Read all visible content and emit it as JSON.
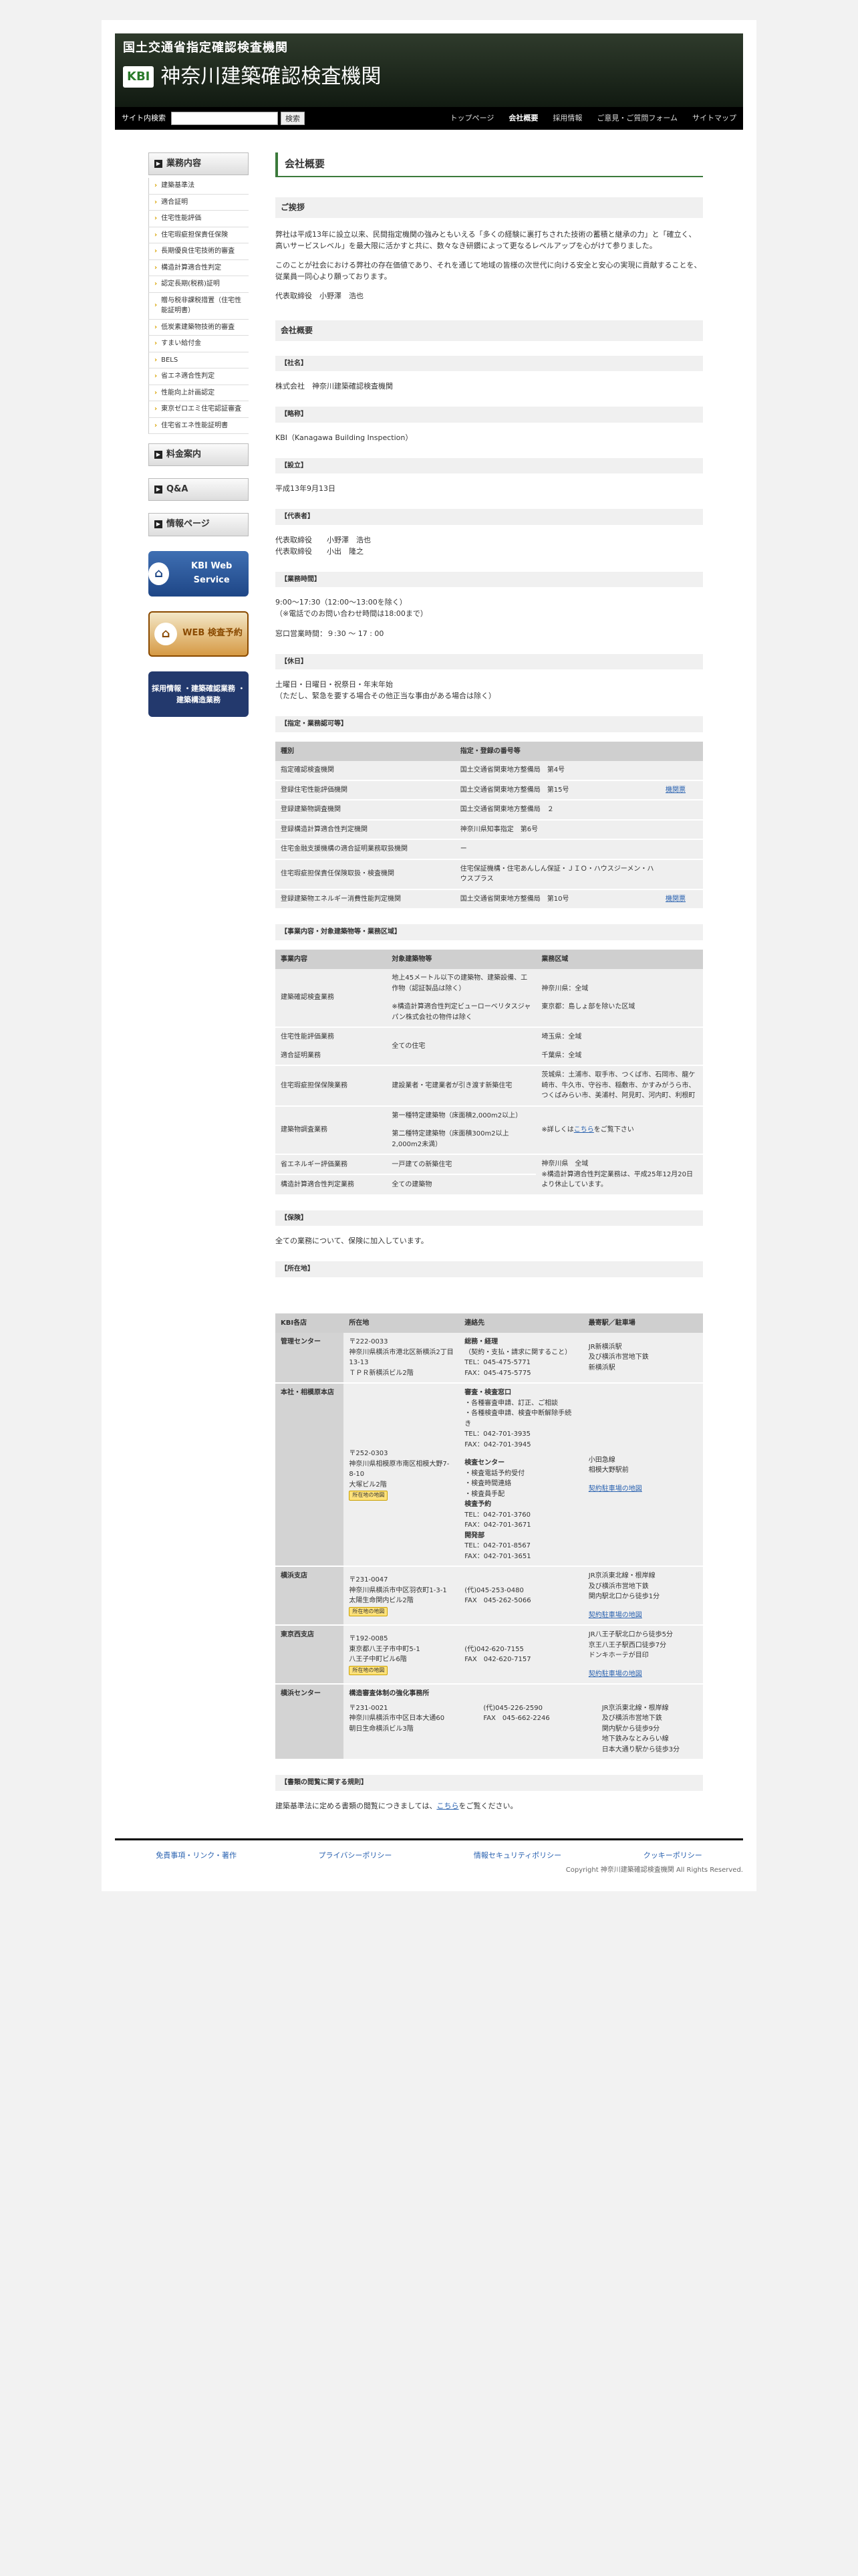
{
  "header": {
    "sub_title": "国土交通省指定確認検査機関",
    "logo": "KBI",
    "name": "神奈川建築確認検査機関"
  },
  "nav": {
    "search_label": "サイト内検索",
    "search_placeholder": "",
    "search_button": "検索",
    "links": [
      "トップページ",
      "会社概要",
      "採用情報",
      "ご意見・ご質問フォーム",
      "サイトマップ"
    ]
  },
  "sidebar": {
    "menu_head": "業務内容",
    "items": [
      "建築基準法",
      "適合証明",
      "住宅性能評価",
      "住宅瑕疵担保責任保険",
      "長期優良住宅技術的審査",
      "構造計算適合性判定",
      "認定長期(税務)証明",
      "贈与税非課税措置（住宅性能証明書）",
      "低炭素建築物技術的審査",
      "すまい給付金",
      "BELS",
      "省エネ適合性判定",
      "性能向上計画認定",
      "東京ゼロエミ住宅認証審査",
      "住宅省エネ性能証明書"
    ],
    "fee": "料金案内",
    "qa": "Q&A",
    "info": "情報ページ",
    "banner_kbi": "KBI Web Service",
    "banner_web": "WEB 検査予約",
    "banner_rec": "採用情報 ・建築確認業務 ・建築構造業務"
  },
  "content": {
    "title": "会社概要",
    "greeting_head": "ご挨拶",
    "greeting_p1": "弊社は平成13年に設立以来、民間指定機関の強みともいえる「多くの経験に裏打ちされた技術の蓄積と継承の力」と「確立く、高いサービスレベル」を最大限に活かすと共に、数々なき研鑽によって更なるレベルアップを心がけて参りました。",
    "greeting_p2": "このことが社会における弊社の存在価値であり、それを通じて地域の皆様の次世代に向ける安全と安心の実現に貢献することを、従業員一同心より願っております。",
    "greeting_sign": "代表取締役　小野澤　浩也",
    "overview_head": "会社概要",
    "s_name_h": "【社名】",
    "s_name": "株式会社　神奈川建築確認検査機関",
    "s_abbr_h": "【略称】",
    "s_abbr": "KBI（Kanagawa Building Inspection）",
    "s_est_h": "【設立】",
    "s_est": "平成13年9月13日",
    "s_rep_h": "【代表者】",
    "s_rep1": "代表取締役　　小野澤　浩也",
    "s_rep2": "代表取締役　　小出　隆之",
    "s_hours_h": "【業務時間】",
    "s_hours1": "9:00〜17:30（12:00〜13:00を除く）",
    "s_hours2": "（※電話でのお問い合わせ時間は18:00まで）",
    "s_hours3": "窓口営業時間：９:30 〜 17 : 00",
    "s_hol_h": "【休日】",
    "s_hol1": "土曜日・日曜日・祝祭日・年末年始",
    "s_hol2": "（ただし、緊急を要する場合その他正当な事由がある場合は除く）",
    "s_reg_h": "【指定・業務認可等】",
    "reg_cols": [
      "種別",
      "指定・登録の番号等",
      ""
    ],
    "reg_rows": [
      [
        "指定確認検査機関",
        "国土交通省関東地方整備局　第4号",
        ""
      ],
      [
        "登録住宅性能評価機関",
        "国土交通省関東地方整備局　第15号",
        "機関票"
      ],
      [
        "登録建築物調査機関",
        "国土交通省関東地方整備局　２",
        ""
      ],
      [
        "登録構造計算適合性判定機関",
        "神奈川県知事指定　第6号",
        ""
      ],
      [
        "住宅金融支援機構の適合証明業務取扱機関",
        "ー",
        ""
      ],
      [
        "住宅瑕疵担保責任保険取扱・検査機関",
        "住宅保証機構・住宅あんしん保証・ＪＩＯ・ハウスジーメン・ハウスプラス",
        ""
      ],
      [
        "登録建築物エネルギー消費性能判定機関",
        "国土交通省関東地方整備局　第10号",
        "機関票"
      ]
    ],
    "s_bus_h": "【事業内容・対象建築物等・業務区域】",
    "bus_cols": [
      "事業内容",
      "対象建築物等",
      "業務区域"
    ],
    "bus_a1": "建築確認検査業務",
    "bus_a2": "住宅性能評価業務",
    "bus_a3": "適合証明業務",
    "bus_a4": "住宅瑕疵担保保険業務",
    "bus_a5": "建築物調査業務",
    "bus_a6": "省エネルギー評価業務",
    "bus_a7": "構造計算適合性判定業務",
    "bus_b1": "地上45メートル以下の建築物、建築設備、工作物（認証製品は除く）",
    "bus_b1n": "※構造計算適合性判定ビューローベリタスジャパン株式会社の物件は除く",
    "bus_b2": "全ての住宅",
    "bus_b3": "建設業者・宅建業者が引き渡す新築住宅",
    "bus_b4": "第一種特定建築物（床面積2,000m2以上）",
    "bus_b4n": "第二種特定建築物（床面積300m2以上2,000m2未満）",
    "bus_b5": "一戸建ての新築住宅",
    "bus_b6": "全ての建築物",
    "bus_c1": "神奈川県：全域",
    "bus_c2": "東京都：島しょ部を除いた区域",
    "bus_c3": "埼玉県：全域",
    "bus_c4": "千葉県：全域",
    "bus_c5": "茨城県：土浦市、取手市、つくば市、石岡市、龍ケ崎市、牛久市、守谷市、稲敷市、かすみがうら市、つくばみらい市、美浦村、阿見町、河内町、利根町",
    "bus_c6": "※詳しくは",
    "bus_c6_link": "こちら",
    "bus_c6b": "をご覧下さい",
    "bus_c7": "神奈川県　全域",
    "bus_c7n": "※構造計算適合性判定業務は、平成25年12月20日より休止しています。",
    "s_ins_h": "【保険】",
    "s_ins": "全ての業務について、保険に加入しています。",
    "s_loc_h": "【所在地】",
    "loc_cols": [
      "KBI各店",
      "所在地",
      "連絡先",
      "最寄駅／駐車場"
    ],
    "loc": {
      "r1_name": "管理センター",
      "r1_addr1": "〒222-0033",
      "r1_addr2": "神奈川県横浜市港北区新横浜2丁目13-13",
      "r1_addr3": "ＴＰＲ新横浜ビル2階",
      "r1_c1": "総務・経理",
      "r1_c2": "（契約・支払・請求に関すること）",
      "r1_c3": "TEL：045-475-5771",
      "r1_c4": "FAX：045-475-5775",
      "r1_s1": "JR新横浜駅",
      "r1_s2": "及び横浜市営地下鉄",
      "r1_s3": "新横浜駅",
      "r2_name": "本社・相模原本店",
      "r2_addr1": "〒252-0303",
      "r2_addr2": "神奈川県相模原市南区相模大野7-8-10",
      "r2_addr3": "大塚ビル2階",
      "r2_map": "所在地の地図",
      "r2_c1": "審査・検査窓口",
      "r2_c2": "・各種審査申請、訂正、ご相談",
      "r2_c3": "・各種検査申請、検査中断解除手続き",
      "r2_c4": "TEL：042-701-3935",
      "r2_c5": "FAX：042-701-3945",
      "r2_c6": "検査センター",
      "r2_c7": "・検査電話予約受付",
      "r2_c8": "・検査時間連絡",
      "r2_c9": "・検査員手配",
      "r2_c10": "検査予約",
      "r2_c11": "TEL：042-701-3760",
      "r2_c12": "FAX：042-701-3671",
      "r2_c13": "開発部",
      "r2_c14": "TEL：042-701-8567",
      "r2_c15": "FAX：042-701-3651",
      "r2_s1": "小田急線",
      "r2_s2": "相模大野駅前",
      "r2_s3": "契約駐車場の地図",
      "r3_name": "横浜支店",
      "r3_addr1": "〒231-0047",
      "r3_addr2": "神奈川県横浜市中区羽衣町1-3-1",
      "r3_addr3": "太陽生命関内ビル2階",
      "r3_map": "所在地の地図",
      "r3_c1": "(代)045-253-0480",
      "r3_c2": "FAX　045-262-5066",
      "r3_s1": "JR京浜東北線・根岸線",
      "r3_s2": "及び横浜市営地下鉄",
      "r3_s3": "関内駅北口から徒歩1分",
      "r3_s4": "契約駐車場の地図",
      "r4_name": "東京西支店",
      "r4_addr1": "〒192-0085",
      "r4_addr2": "東京都八王子市中町5-1",
      "r4_addr3": "八王子中町ビル6階",
      "r4_map": "所在地の地図",
      "r4_c1": "(代)042-620-7155",
      "r4_c2": "FAX　042-620-7157",
      "r4_s1": "JR八王子駅北口から徒歩5分",
      "r4_s2": "京王八王子駅西口徒歩7分",
      "r4_s3": "ドンキホーテが目印",
      "r4_s4": "契約駐車場の地図",
      "r5_name": "横浜センター",
      "r5_top": "構造審査体制の強化事務所",
      "r5_addr1": "〒231-0021",
      "r5_addr2": "神奈川県横浜市中区日本大通60",
      "r5_addr3": "朝日生命横浜ビル3階",
      "r5_c1": "(代)045-226-2590",
      "r5_c2": "FAX　045-662-2246",
      "r5_s1": "JR京浜東北線・根岸線",
      "r5_s2": "及び横浜市営地下鉄",
      "r5_s3": "関内駅から徒歩9分",
      "r5_s4": "地下鉄みなとみらい線",
      "r5_s5": "日本大通り駅から徒歩3分"
    },
    "s_doc_h": "【書類の閲覧に関する規則】",
    "s_doc1": "建築基準法に定める書類の閲覧につきましては、",
    "s_doc_link": "こちら",
    "s_doc2": "をご覧ください。"
  },
  "footer": {
    "l1": "免責事項・リンク・著作",
    "l2": "プライバシーポリシー",
    "l3": "情報セキュリティポリシー",
    "l4": "クッキーポリシー",
    "copy": "Copyright 神奈川建築確認検査機関 All Rights Reserved."
  }
}
